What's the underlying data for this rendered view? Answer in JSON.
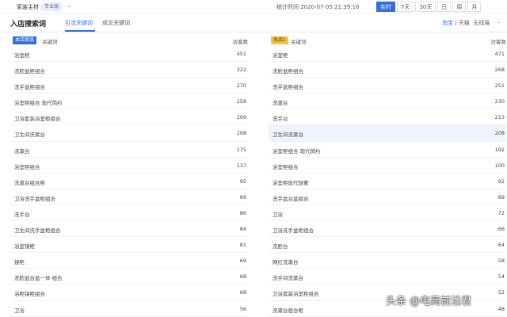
{
  "topbar": {
    "shop_name": "家装主材",
    "edition": "专业版",
    "stat_time": "统计时间 2020-07-05 21:39:16",
    "periods": [
      {
        "label": "实时",
        "active": true
      },
      {
        "label": "7天",
        "active": false
      },
      {
        "label": "30天",
        "active": false
      },
      {
        "label": "日",
        "active": false
      },
      {
        "label": "周",
        "active": false
      },
      {
        "label": "月",
        "active": false
      }
    ]
  },
  "header": {
    "title": "入店搜索词",
    "tabs": [
      {
        "label": "引流关键词",
        "active": true
      },
      {
        "label": "成交关键词",
        "active": false
      }
    ],
    "channel_taobao": "淘宝",
    "channel_sep": " | ",
    "channel_tmall": "天猫",
    "device": "无线端"
  },
  "left_panel": {
    "badge": "本店商品",
    "keyword_header": "关键词",
    "count_header": "访客数",
    "rows": [
      {
        "keyword": "浴室柜",
        "count": "451"
      },
      {
        "keyword": "洗脸盆柜组合",
        "count": "322"
      },
      {
        "keyword": "洗手盆柜组合",
        "count": "270"
      },
      {
        "keyword": "浴室柜组合 现代简约",
        "count": "258"
      },
      {
        "keyword": "卫浴套装浴室柜组合",
        "count": "209"
      },
      {
        "keyword": "卫生间洗漱台",
        "count": "208"
      },
      {
        "keyword": "洗漱台",
        "count": "175"
      },
      {
        "keyword": "浴室柜组合",
        "count": "137"
      },
      {
        "keyword": "洗漱台组合柜",
        "count": "95"
      },
      {
        "keyword": "卫浴洗手盆柜组合",
        "count": "89"
      },
      {
        "keyword": "洗手台",
        "count": "86"
      },
      {
        "keyword": "卫生间洗手盆柜组合",
        "count": "84"
      },
      {
        "keyword": "浴室镜柜",
        "count": "81"
      },
      {
        "keyword": "镜柜",
        "count": "69"
      },
      {
        "keyword": "洗脸盆台盆一体 组合",
        "count": "68"
      },
      {
        "keyword": "浴柜镜柜组合",
        "count": "68"
      },
      {
        "keyword": "卫浴",
        "count": "56"
      }
    ]
  },
  "right_panel": {
    "badge": "竞品1",
    "keyword_header": "关键词",
    "count_header": "访客数",
    "rows": [
      {
        "keyword": "浴室柜",
        "count": "471"
      },
      {
        "keyword": "洗脸盆柜组合",
        "count": "268"
      },
      {
        "keyword": "洗手盆柜组合",
        "count": "251"
      },
      {
        "keyword": "洗漱台",
        "count": "230"
      },
      {
        "keyword": "洗手台",
        "count": "213"
      },
      {
        "keyword": "卫生间洗漱台",
        "count": "208"
      },
      {
        "keyword": "浴室柜组合 现代简约",
        "count": "192"
      },
      {
        "keyword": "浴室柜组合",
        "count": "100"
      },
      {
        "keyword": "浴室柜现代轻奢",
        "count": "92"
      },
      {
        "keyword": "洗手盆台盆组合",
        "count": "89"
      },
      {
        "keyword": "卫浴",
        "count": "72"
      },
      {
        "keyword": "卫浴洗手盆柜组合",
        "count": "66"
      },
      {
        "keyword": "洗脸台",
        "count": "64"
      },
      {
        "keyword": "网红洗漱台",
        "count": "58"
      },
      {
        "keyword": "洗手间洗漱台",
        "count": "54"
      },
      {
        "keyword": "卫浴套装浴室柜组合",
        "count": "52"
      },
      {
        "keyword": "洗漱台组合柜",
        "count": "48"
      }
    ]
  },
  "highlight_row_index": 5,
  "watermark": "头条 @电商前沿君"
}
